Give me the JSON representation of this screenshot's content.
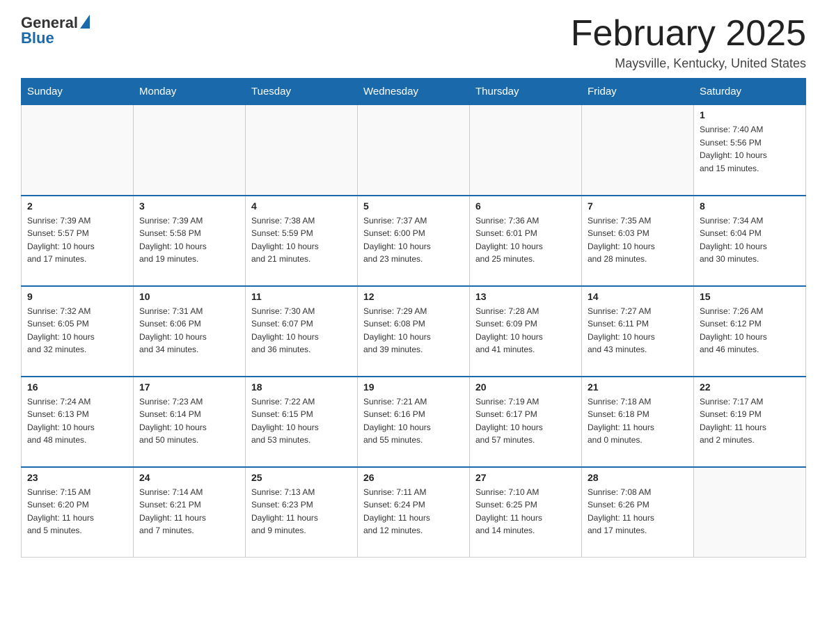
{
  "logo": {
    "general": "General",
    "blue": "Blue"
  },
  "title": "February 2025",
  "location": "Maysville, Kentucky, United States",
  "days_of_week": [
    "Sunday",
    "Monday",
    "Tuesday",
    "Wednesday",
    "Thursday",
    "Friday",
    "Saturday"
  ],
  "weeks": [
    [
      {
        "day": "",
        "info": ""
      },
      {
        "day": "",
        "info": ""
      },
      {
        "day": "",
        "info": ""
      },
      {
        "day": "",
        "info": ""
      },
      {
        "day": "",
        "info": ""
      },
      {
        "day": "",
        "info": ""
      },
      {
        "day": "1",
        "info": "Sunrise: 7:40 AM\nSunset: 5:56 PM\nDaylight: 10 hours\nand 15 minutes."
      }
    ],
    [
      {
        "day": "2",
        "info": "Sunrise: 7:39 AM\nSunset: 5:57 PM\nDaylight: 10 hours\nand 17 minutes."
      },
      {
        "day": "3",
        "info": "Sunrise: 7:39 AM\nSunset: 5:58 PM\nDaylight: 10 hours\nand 19 minutes."
      },
      {
        "day": "4",
        "info": "Sunrise: 7:38 AM\nSunset: 5:59 PM\nDaylight: 10 hours\nand 21 minutes."
      },
      {
        "day": "5",
        "info": "Sunrise: 7:37 AM\nSunset: 6:00 PM\nDaylight: 10 hours\nand 23 minutes."
      },
      {
        "day": "6",
        "info": "Sunrise: 7:36 AM\nSunset: 6:01 PM\nDaylight: 10 hours\nand 25 minutes."
      },
      {
        "day": "7",
        "info": "Sunrise: 7:35 AM\nSunset: 6:03 PM\nDaylight: 10 hours\nand 28 minutes."
      },
      {
        "day": "8",
        "info": "Sunrise: 7:34 AM\nSunset: 6:04 PM\nDaylight: 10 hours\nand 30 minutes."
      }
    ],
    [
      {
        "day": "9",
        "info": "Sunrise: 7:32 AM\nSunset: 6:05 PM\nDaylight: 10 hours\nand 32 minutes."
      },
      {
        "day": "10",
        "info": "Sunrise: 7:31 AM\nSunset: 6:06 PM\nDaylight: 10 hours\nand 34 minutes."
      },
      {
        "day": "11",
        "info": "Sunrise: 7:30 AM\nSunset: 6:07 PM\nDaylight: 10 hours\nand 36 minutes."
      },
      {
        "day": "12",
        "info": "Sunrise: 7:29 AM\nSunset: 6:08 PM\nDaylight: 10 hours\nand 39 minutes."
      },
      {
        "day": "13",
        "info": "Sunrise: 7:28 AM\nSunset: 6:09 PM\nDaylight: 10 hours\nand 41 minutes."
      },
      {
        "day": "14",
        "info": "Sunrise: 7:27 AM\nSunset: 6:11 PM\nDaylight: 10 hours\nand 43 minutes."
      },
      {
        "day": "15",
        "info": "Sunrise: 7:26 AM\nSunset: 6:12 PM\nDaylight: 10 hours\nand 46 minutes."
      }
    ],
    [
      {
        "day": "16",
        "info": "Sunrise: 7:24 AM\nSunset: 6:13 PM\nDaylight: 10 hours\nand 48 minutes."
      },
      {
        "day": "17",
        "info": "Sunrise: 7:23 AM\nSunset: 6:14 PM\nDaylight: 10 hours\nand 50 minutes."
      },
      {
        "day": "18",
        "info": "Sunrise: 7:22 AM\nSunset: 6:15 PM\nDaylight: 10 hours\nand 53 minutes."
      },
      {
        "day": "19",
        "info": "Sunrise: 7:21 AM\nSunset: 6:16 PM\nDaylight: 10 hours\nand 55 minutes."
      },
      {
        "day": "20",
        "info": "Sunrise: 7:19 AM\nSunset: 6:17 PM\nDaylight: 10 hours\nand 57 minutes."
      },
      {
        "day": "21",
        "info": "Sunrise: 7:18 AM\nSunset: 6:18 PM\nDaylight: 11 hours\nand 0 minutes."
      },
      {
        "day": "22",
        "info": "Sunrise: 7:17 AM\nSunset: 6:19 PM\nDaylight: 11 hours\nand 2 minutes."
      }
    ],
    [
      {
        "day": "23",
        "info": "Sunrise: 7:15 AM\nSunset: 6:20 PM\nDaylight: 11 hours\nand 5 minutes."
      },
      {
        "day": "24",
        "info": "Sunrise: 7:14 AM\nSunset: 6:21 PM\nDaylight: 11 hours\nand 7 minutes."
      },
      {
        "day": "25",
        "info": "Sunrise: 7:13 AM\nSunset: 6:23 PM\nDaylight: 11 hours\nand 9 minutes."
      },
      {
        "day": "26",
        "info": "Sunrise: 7:11 AM\nSunset: 6:24 PM\nDaylight: 11 hours\nand 12 minutes."
      },
      {
        "day": "27",
        "info": "Sunrise: 7:10 AM\nSunset: 6:25 PM\nDaylight: 11 hours\nand 14 minutes."
      },
      {
        "day": "28",
        "info": "Sunrise: 7:08 AM\nSunset: 6:26 PM\nDaylight: 11 hours\nand 17 minutes."
      },
      {
        "day": "",
        "info": ""
      }
    ]
  ]
}
